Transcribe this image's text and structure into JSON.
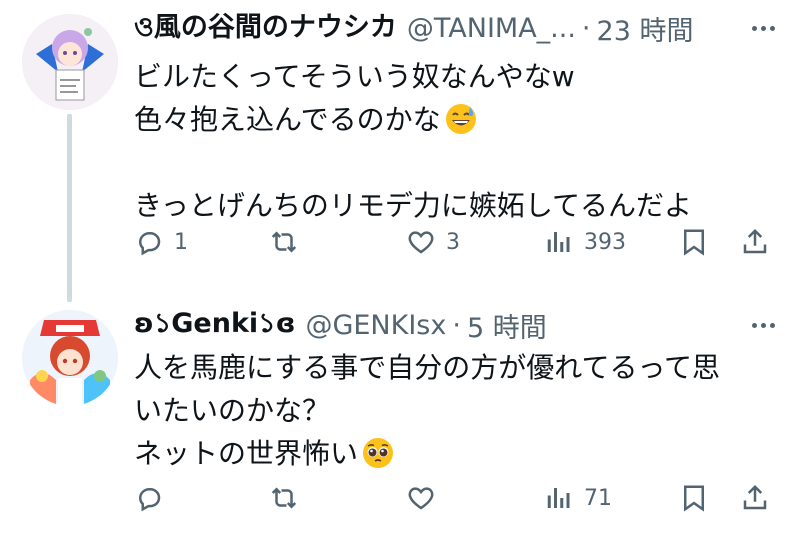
{
  "tweets": [
    {
      "display_name": "ও風の谷間のナウシカ",
      "handle": "@TANIMA_...",
      "separator": "·",
      "time": "23 時間",
      "lines": [
        "ビルたくってそういう奴なんやなw",
        "色々抱え込んでるのかな",
        "",
        "きっとげんちのリモデ力に嫉妬してるんだよ"
      ],
      "emoji": "sweat-smile-emoji",
      "actions": {
        "reply": "1",
        "retweet": "",
        "like": "3",
        "views": "393"
      }
    },
    {
      "display_name": "ʚ১Genki১ɞ",
      "handle": "@GENKIsx",
      "separator": "·",
      "time": "5 時間",
      "lines": [
        "人を馬鹿にする事で自分の方が優れてるって思",
        "いたいのかな？",
        "ネットの世界怖い"
      ],
      "emoji": "pleading-face-emoji",
      "actions": {
        "reply": "",
        "retweet": "",
        "like": "",
        "views": "71"
      }
    }
  ],
  "icons": {
    "reply": "reply-icon",
    "retweet": "retweet-icon",
    "like": "like-icon",
    "views": "views-icon",
    "bookmark": "bookmark-icon",
    "share": "share-icon",
    "more": "more-icon"
  },
  "colors": {
    "text": "#0f1419",
    "secondary": "#536471",
    "thread_line": "#cfd9de",
    "background": "#ffffff"
  }
}
